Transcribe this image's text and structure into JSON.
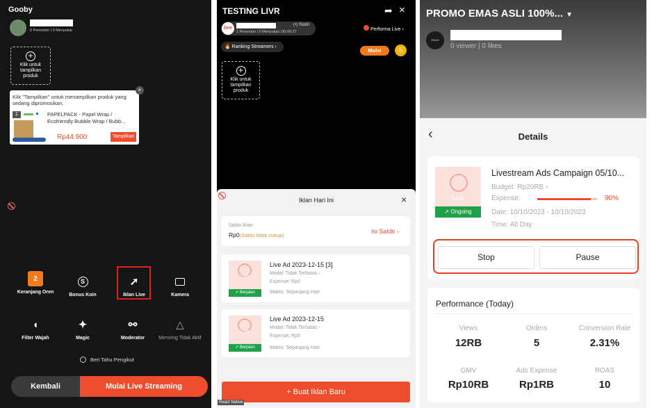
{
  "panel1": {
    "title": "Gooby",
    "stats": "0 Penonton | 0 Menyukai",
    "add_product": [
      "Klik untuk",
      "tampilkan",
      "produk"
    ],
    "tooltip": "Klik \"Tampilkan\" untuk menampilkan produk yang sedang dipromosikan.",
    "product": {
      "index": "1",
      "name_line1": "PAPELPACK -  Papel Wrap /",
      "name_line2": "Ecofriendly Bubble Wrap / Bubb...",
      "price": "Rp44.900",
      "button": "Tampilkan"
    },
    "toolbar_row1": [
      {
        "label": "Keranjang Oren",
        "badge": "2"
      },
      {
        "label": "Bonus Koin"
      },
      {
        "label": "Iklan Live"
      },
      {
        "label": "Kamera"
      }
    ],
    "toolbar_row2": [
      {
        "label": "Filter Wajah"
      },
      {
        "label": "Magic"
      },
      {
        "label": "Moderator"
      },
      {
        "label": "Mirroring Tidak Aktif"
      }
    ],
    "notify_followers": "Beri Tahu Pengikut",
    "back_button": "Kembali",
    "start_button": "Mulai Live Streaming"
  },
  "panel2": {
    "title": "TESTING LIVR",
    "avatar_text": "bee",
    "stable": "Stabil",
    "stats": "1 Penonton | 0 Menyukai | 00:00:27",
    "performance": "Performa Live",
    "ranking": "Ranking Streamers",
    "mulai": "Mulai",
    "add_product": [
      "Klik untuk",
      "tampilkan",
      "produk"
    ],
    "sheet_title": "Iklan Hari Ini",
    "balance_label": "Saldo Iklan",
    "balance_value": "Rp0",
    "balance_note": "(Saldo tidak cukup)",
    "topup": "Isi Saldo",
    "ads": [
      {
        "title": "Live Ad 2023-12-15 [3]",
        "modal": "Modal: Tidak Terbatas",
        "expense": "Expense: Rp0",
        "time": "Waktu: Sepanjang Hari",
        "status": "Berjalan",
        "live": "Live"
      },
      {
        "title": "Live Ad 2023-12-15",
        "modal": "Modal: Tidak Terbatas",
        "expense": "Expense: Rp0",
        "time": "Waktu: Sepanjang Hari",
        "status": "Berjalan",
        "live": "Live"
      }
    ],
    "create_button": "+ Buat Iklan Baru",
    "footer_tag": "React Native"
  },
  "panel3": {
    "title": "PROMO EMAS ASLI 100%...",
    "stats": "0 viewer | 0 likes",
    "avatar_text": "EMAS",
    "header": "Details",
    "campaign": {
      "title": "Livestream Ads Campaign 05/10...",
      "budget": "Budget: Rp20RB",
      "expense_label": "Expense:",
      "expense_pct": "90%",
      "expense_fraction": 0.9,
      "date": "Date: 10/10/2023 - 10/10/2023",
      "time": "Time: All Day",
      "status": "Ongoing",
      "live": "Live"
    },
    "stop": "Stop",
    "pause": "Pause",
    "perf_title": "Performance (Today)",
    "metrics": [
      {
        "label": "Views",
        "value": "12RB"
      },
      {
        "label": "Orders",
        "value": "5"
      },
      {
        "label": "Conversion Rate",
        "value": "2.31%"
      },
      {
        "label": "GMV",
        "value": "Rp10RB"
      },
      {
        "label": "Ads Expense",
        "value": "Rp1RB"
      },
      {
        "label": "ROAS",
        "value": "10"
      }
    ]
  },
  "colors": {
    "accent": "#ee4d2d",
    "green": "#1fa14a",
    "highlight": "#e8401c"
  }
}
